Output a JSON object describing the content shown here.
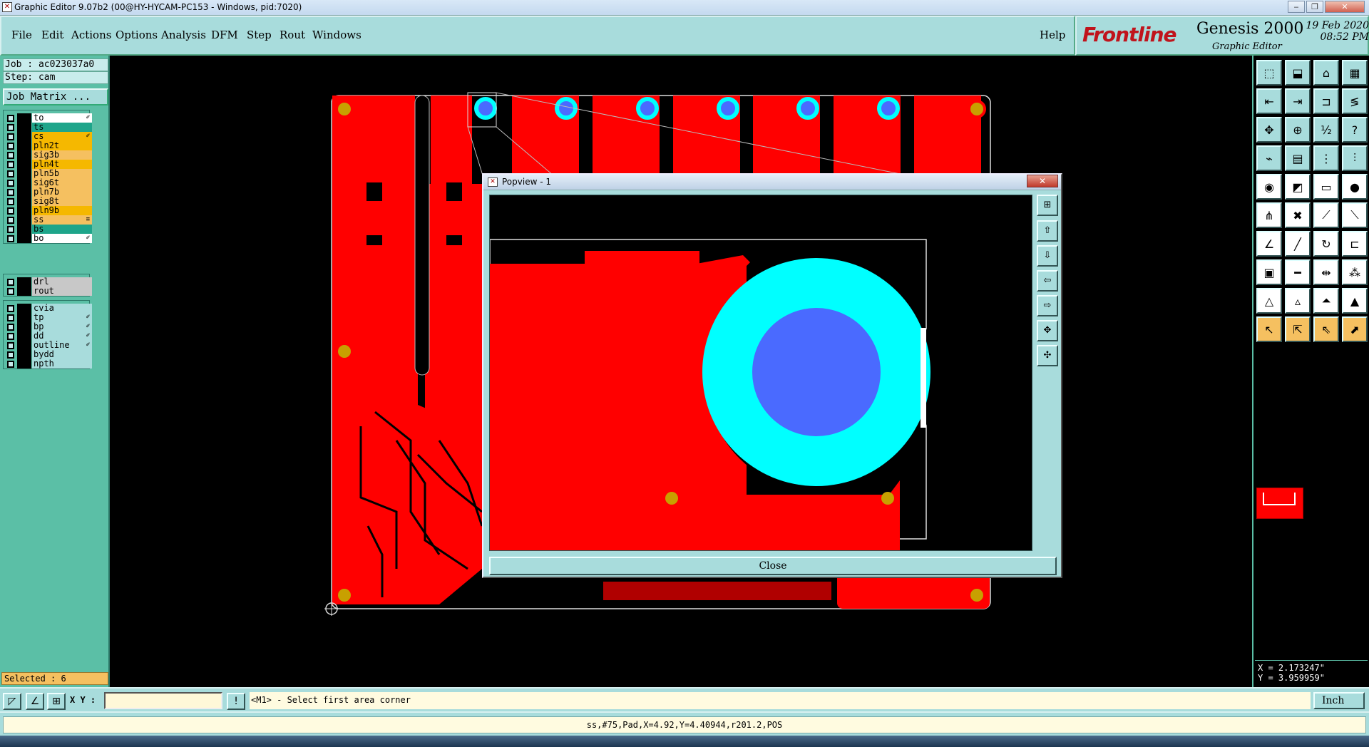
{
  "window": {
    "title": "Graphic Editor 9.07b2 (00@HY-HYCAM-PC153 - Windows, pid:7020)",
    "minimize": "‒",
    "restore": "❐",
    "close": "✕"
  },
  "menu": {
    "items": [
      "File",
      "Edit",
      "Actions",
      "Options",
      "Analysis",
      "DFM",
      "Step",
      "Rout",
      "Windows"
    ],
    "help": "Help"
  },
  "brand": {
    "logo": "Frontline",
    "product": "Genesis 2000",
    "subtitle": "Graphic Editor",
    "date": "19 Feb 2020",
    "time": "08:52 PM"
  },
  "left": {
    "job": "Job : ac023037a0",
    "step": "Step: cam",
    "job_matrix": "Job Matrix ...",
    "layers_group1": [
      {
        "name": "to",
        "color": "#ffffff",
        "mark": "✐"
      },
      {
        "name": "ts",
        "color": "#1ea58a",
        "mark": ""
      },
      {
        "name": "cs",
        "color": "#f5b800",
        "mark": "✐"
      },
      {
        "name": "pln2t",
        "color": "#f5b800",
        "mark": ""
      },
      {
        "name": "sig3b",
        "color": "#f5c060",
        "mark": ""
      },
      {
        "name": "pln4t",
        "color": "#f5b800",
        "mark": ""
      },
      {
        "name": "pln5b",
        "color": "#f5c060",
        "mark": ""
      },
      {
        "name": "sig6t",
        "color": "#f5c060",
        "mark": ""
      },
      {
        "name": "pln7b",
        "color": "#f5c060",
        "mark": ""
      },
      {
        "name": "sig8t",
        "color": "#f5c060",
        "mark": ""
      },
      {
        "name": "pln9b",
        "color": "#f5b800",
        "mark": ""
      },
      {
        "name": "ss",
        "color": "#f5c060",
        "mark": "≡"
      },
      {
        "name": "bs",
        "color": "#1ea58a",
        "mark": ""
      },
      {
        "name": "bo",
        "color": "#ffffff",
        "mark": "✐"
      }
    ],
    "layers_group2": [
      {
        "name": "drl",
        "color": "#c8c8c8",
        "mark": ""
      },
      {
        "name": "rout",
        "color": "#c8c8c8",
        "mark": ""
      }
    ],
    "layers_group3": [
      {
        "name": "cvia",
        "color": "#a8dcdc",
        "mark": ""
      },
      {
        "name": "tp",
        "color": "#a8dcdc",
        "mark": "✐"
      },
      {
        "name": "bp",
        "color": "#a8dcdc",
        "mark": "✐"
      },
      {
        "name": "dd",
        "color": "#a8dcdc",
        "mark": "✐"
      },
      {
        "name": "outline",
        "color": "#a8dcdc",
        "mark": "✐"
      },
      {
        "name": "bydd",
        "color": "#a8dcdc",
        "mark": ""
      },
      {
        "name": "npth",
        "color": "#a8dcdc",
        "mark": ""
      }
    ],
    "selected": "Selected : 6"
  },
  "popview": {
    "title": "Popview - 1",
    "close_label": "Close",
    "close_x": "✕"
  },
  "coords": {
    "x": "X = 2.173247\"",
    "y": "Y = 3.959959\""
  },
  "bottom": {
    "xy_label": "X Y :",
    "xy_value": "",
    "prompt": "<M1> - Select first area corner",
    "unit": "Inch"
  },
  "status": "ss,#75,Pad,X=4.92,Y=4.40944,r201.2,POS",
  "colors": {
    "copper": "#ff0000",
    "pad": "#00ffff",
    "hole": "#4a6aff",
    "via": "#c8a000",
    "panel": "#a8dcdc",
    "panel_dark": "#5bbfa6"
  }
}
